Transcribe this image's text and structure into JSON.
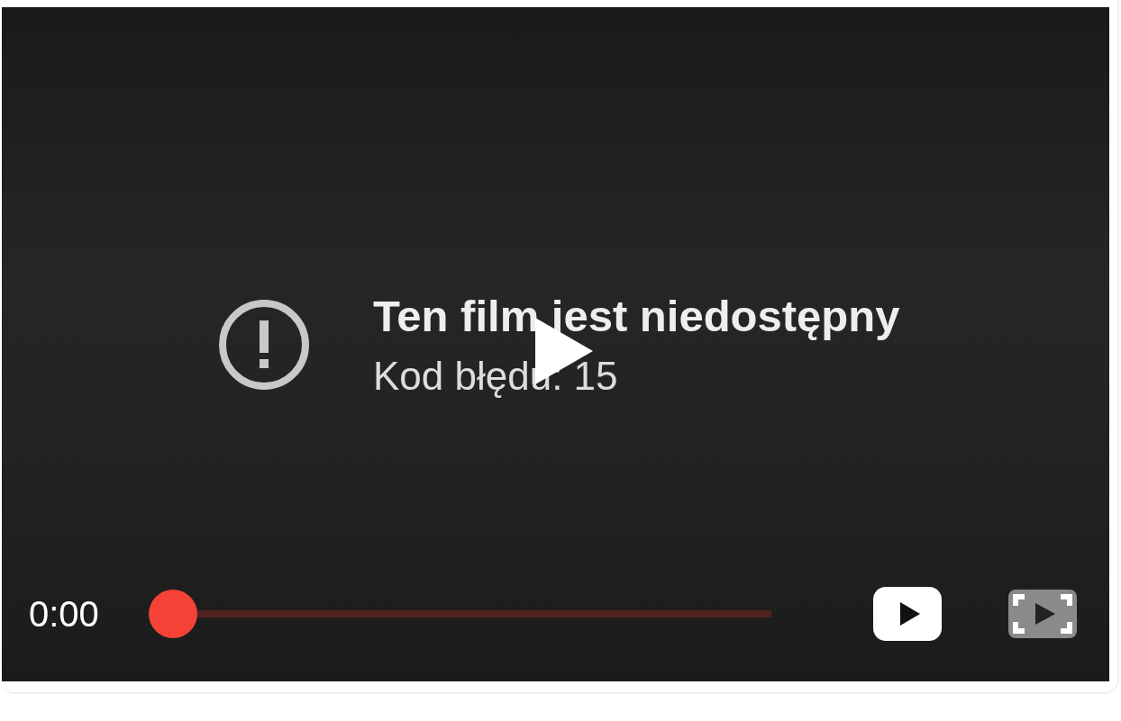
{
  "error": {
    "title": "Ten film jest niedostępny",
    "code": "Kod błędu: 15"
  },
  "controls": {
    "time": "0:00",
    "progress": {
      "level": 0
    }
  }
}
